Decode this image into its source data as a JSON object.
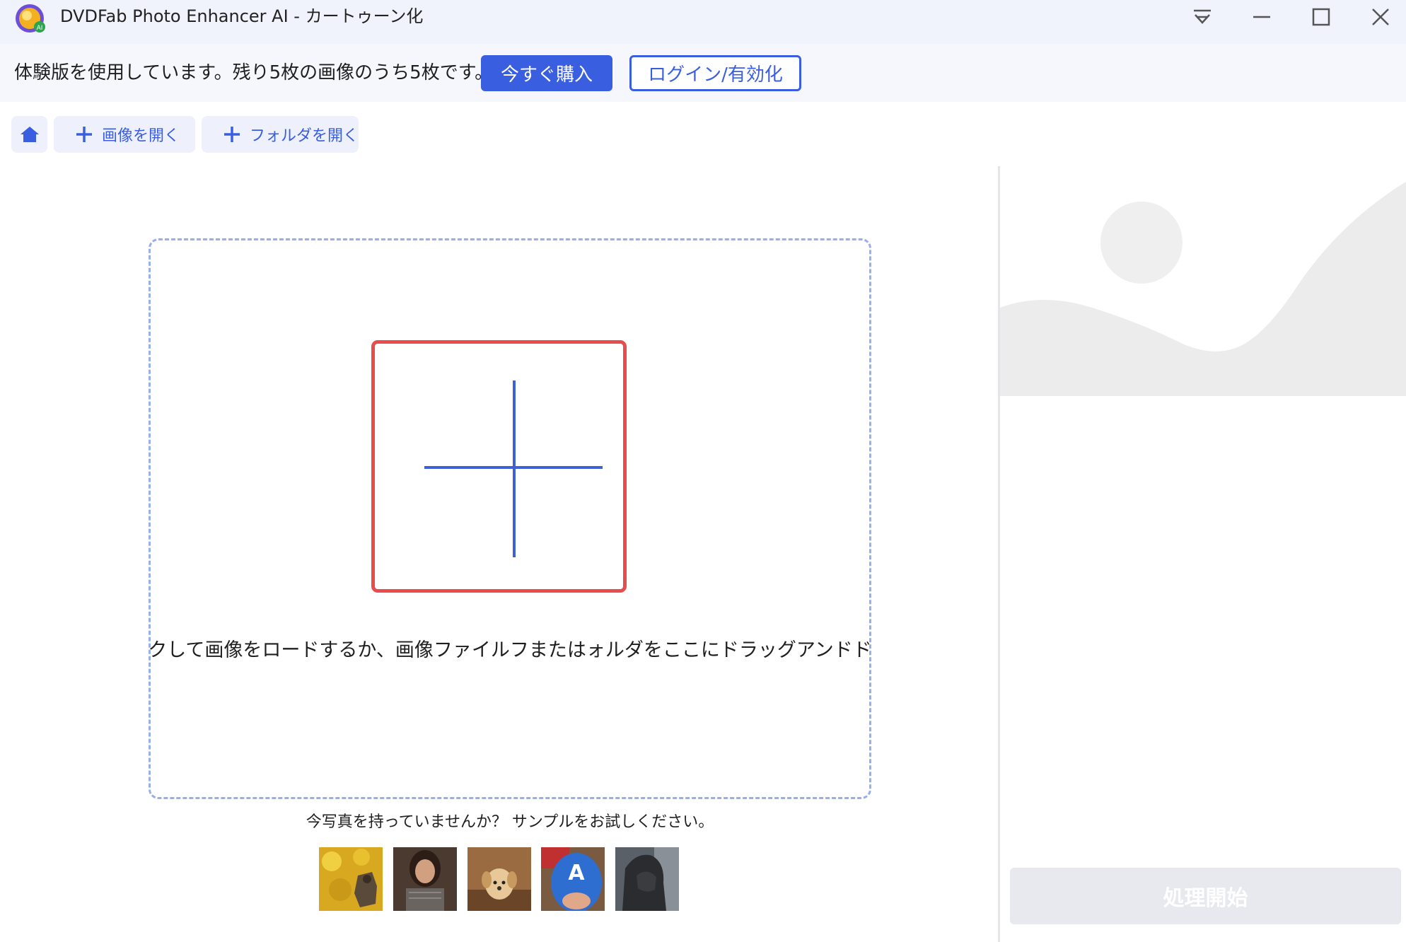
{
  "window": {
    "title": "DVDFab Photo Enhancer AI - カートゥーン化",
    "logo_icon": "dvdfab-photo-enhancer-logo",
    "controls": [
      "dropdown-menu-icon",
      "minimize-icon",
      "maximize-icon",
      "close-icon"
    ]
  },
  "trial_bar": {
    "message": "体験版を使用しています。残り5枚の画像のうち5枚です。",
    "buy_label": "今すぐ購入",
    "login_label": "ログイン/有効化"
  },
  "toolbar": {
    "home_icon": "home-icon",
    "open_image_label": "画像を開く",
    "open_folder_label": "フォルダを開く"
  },
  "dropzone": {
    "add_icon": "plus-icon",
    "hint": "ここをクリックして画像をロードするか、画像ファイルフまたはォルダをここにドラッグアンドドロップします"
  },
  "samples": {
    "prompt": "今写真を持っていませんか？ サンプルをお試しください。",
    "thumbnails": [
      "autumn-dog-photo",
      "woman-portrait-photo",
      "puppy-photo",
      "captain-america-mask-photo",
      "hooded-figure-photo"
    ]
  },
  "preview": {
    "placeholder_icon": "image-placeholder-icon"
  },
  "actions": {
    "process_label": "処理開始"
  },
  "colors": {
    "accent": "#3a5ee0",
    "highlight": "#e84c4c",
    "dashed_border": "#9aaee8",
    "titlebar_bg": "#f0f3fc",
    "disabled_button": "#e8e9ee"
  }
}
